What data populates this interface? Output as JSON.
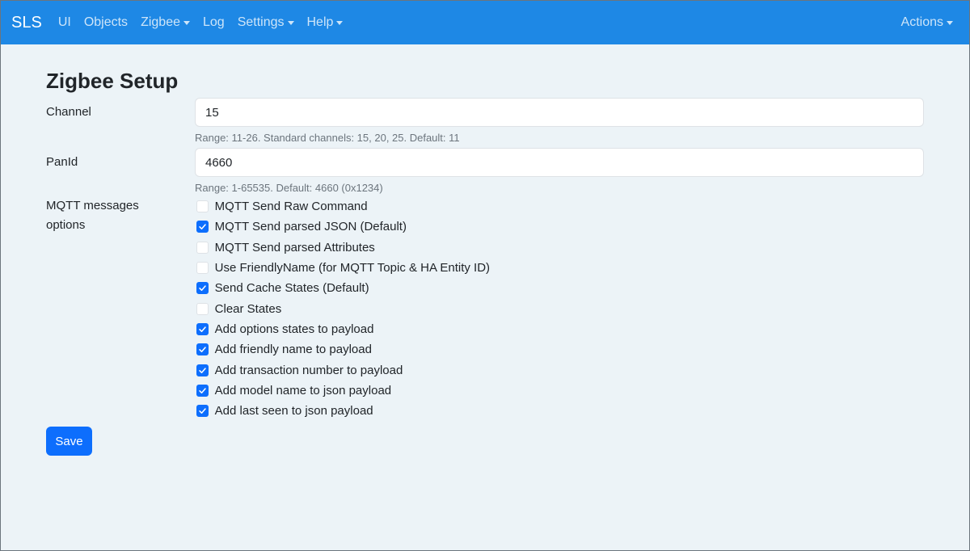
{
  "navbar": {
    "brand": "SLS",
    "items": [
      {
        "label": "UI",
        "dropdown": false
      },
      {
        "label": "Objects",
        "dropdown": false
      },
      {
        "label": "Zigbee",
        "dropdown": true
      },
      {
        "label": "Log",
        "dropdown": false
      },
      {
        "label": "Settings",
        "dropdown": true
      },
      {
        "label": "Help",
        "dropdown": true
      }
    ],
    "actions_label": "Actions"
  },
  "page": {
    "title": "Zigbee Setup"
  },
  "channel": {
    "label": "Channel",
    "value": "15",
    "help": "Range: 11-26. Standard channels: 15, 20, 25. Default: 11"
  },
  "panid": {
    "label": "PanId",
    "value": "4660",
    "help": "Range: 1-65535. Default: 4660 (0x1234)"
  },
  "mqtt": {
    "label_line1": "MQTT messages",
    "label_line2": "options",
    "options": [
      {
        "label": "MQTT Send Raw Command",
        "checked": false
      },
      {
        "label": "MQTT Send parsed JSON (Default)",
        "checked": true
      },
      {
        "label": "MQTT Send parsed Attributes",
        "checked": false
      },
      {
        "label": "Use FriendlyName (for MQTT Topic & HA Entity ID)",
        "checked": false
      },
      {
        "label": "Send Cache States (Default)",
        "checked": true
      },
      {
        "label": "Clear States",
        "checked": false
      },
      {
        "label": "Add options states to payload",
        "checked": true
      },
      {
        "label": "Add friendly name to payload",
        "checked": true
      },
      {
        "label": "Add transaction number to payload",
        "checked": true
      },
      {
        "label": "Add model name to json payload",
        "checked": true
      },
      {
        "label": "Add last seen to json payload",
        "checked": true
      }
    ]
  },
  "save_label": "Save",
  "colors": {
    "navbar": "#1e88e5",
    "primary": "#0d6efd",
    "background": "#ecf3f7"
  }
}
